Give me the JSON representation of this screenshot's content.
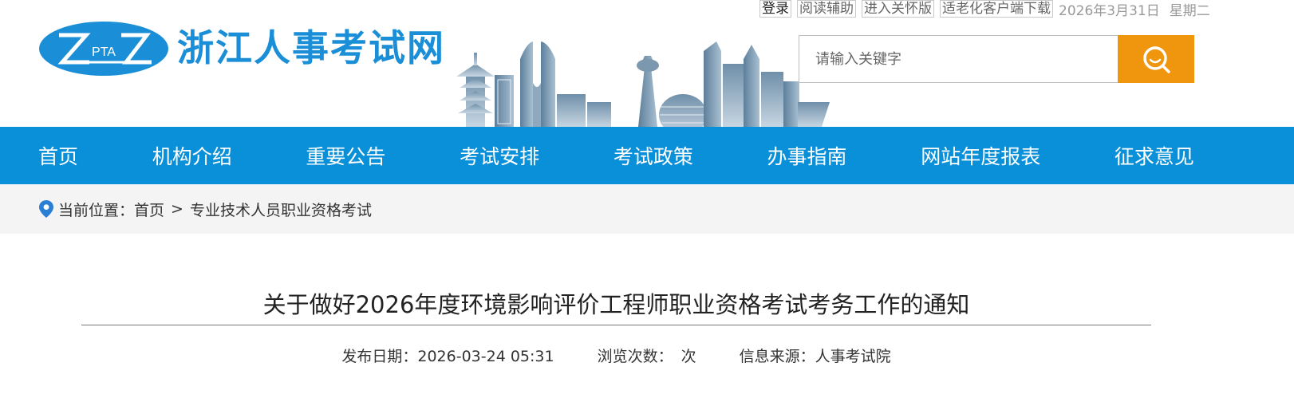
{
  "header": {
    "site_name": "浙江人事考试网",
    "logo_mark_text": "PTA",
    "top_links": [
      "登录",
      "阅读辅助",
      "进入关怀版",
      "适老化客户端下载"
    ],
    "date": "2026年3月31日",
    "weekday": "星期二",
    "search": {
      "placeholder": "请输入关键字",
      "value": ""
    }
  },
  "nav": {
    "items": [
      "首页",
      "机构介绍",
      "重要公告",
      "考试安排",
      "考试政策",
      "办事指南",
      "网站年度报表",
      "征求意见"
    ]
  },
  "breadcrumb": {
    "label": "当前位置：",
    "home": "首页",
    "separator": ">",
    "current": "专业技术人员职业资格考试"
  },
  "article": {
    "title": "关于做好2026年度环境影响评价工程师职业资格考试考务工作的通知",
    "publish_label": "发布日期：",
    "publish_value": "2026-03-24 05:31",
    "views_label": "浏览次数：",
    "views_suffix": "次",
    "source_label": "信息来源：",
    "source_value": "人事考试院"
  },
  "colors": {
    "brand_blue": "#0a8fd9",
    "logo_blue": "#1a8fd8",
    "search_orange": "#f0960e"
  },
  "icons": {
    "search": "magnifier-icon",
    "location": "location-pin-icon"
  }
}
